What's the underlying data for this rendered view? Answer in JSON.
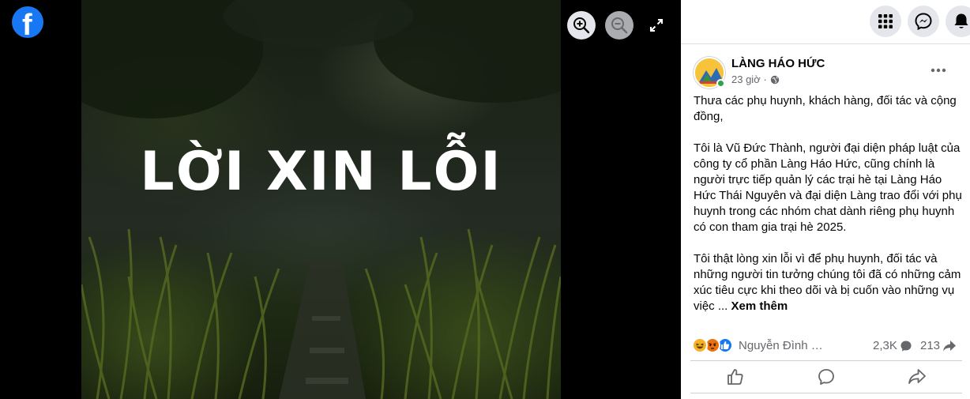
{
  "viewer": {
    "photo_title": "LỜI XIN LỖI",
    "brand_icon": "facebook-logo-icon",
    "controls": {
      "zoom_in_icon": "zoom-in-icon",
      "zoom_out_icon": "zoom-out-icon",
      "fullscreen_icon": "fullscreen-icon"
    }
  },
  "header": {
    "menu_icon": "grid-menu-icon",
    "messenger_icon": "messenger-icon",
    "notifications_icon": "bell-icon"
  },
  "post": {
    "author": "LÀNG HÁO HỨC",
    "time": "23 giờ ·",
    "audience_icon": "globe-icon",
    "paragraphs": [
      "Thưa các phụ huynh, khách hàng, đối tác và cộng đồng,",
      "Tôi là Vũ Đức Thành, người đại diện pháp luật của công ty cổ phần Làng Háo Hức, cũng chính là người trực tiếp quản lý các trại hè tại Làng Háo Hức Thái Nguyên và đại diện Làng trao đổi với phụ huynh trong các nhóm chat dành riêng phụ huynh có con tham gia trại hè 2025.",
      "Tôi thật lòng xin lỗi vì để phụ huynh, đối tác và những người tin tưởng chúng tôi đã có những cảm xúc tiêu cực khi theo dõi và bị cuốn vào những vụ việc ..."
    ],
    "see_more": "Xem thêm",
    "reactions": {
      "icons": [
        "haha-icon",
        "angry-icon",
        "like-icon"
      ],
      "names": "Nguyễn Đình và những người khác",
      "comments": "2,3K",
      "shares": "213"
    },
    "actions": {
      "like_icon": "thumbs-up-icon",
      "comment_icon": "comment-icon",
      "share_icon": "share-icon"
    }
  },
  "colors": {
    "facebook_blue": "#1877f2",
    "online_green": "#31a24c",
    "secondary_text": "#65676b"
  }
}
